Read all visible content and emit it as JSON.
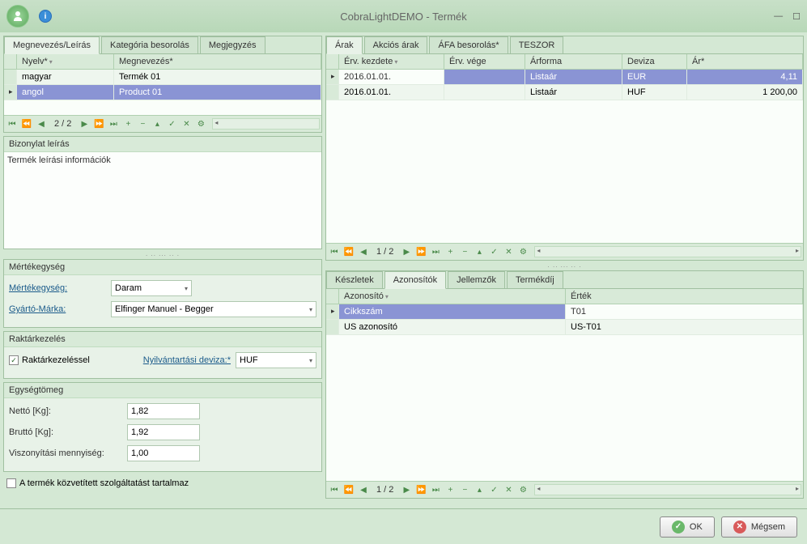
{
  "window": {
    "title": "CobraLightDEMO - Termék"
  },
  "left": {
    "tabs": [
      "Megnevezés/Leírás",
      "Kategória besorolás",
      "Megjegyzés"
    ],
    "activeTab": 0,
    "nameGrid": {
      "columns": [
        "Nyelv*",
        "Megnevezés*"
      ],
      "rows": [
        {
          "lang": "magyar",
          "name": "Termék 01",
          "selected": false
        },
        {
          "lang": "angol",
          "name": "Product 01",
          "selected": true
        }
      ],
      "nav": "2 / 2"
    },
    "descSection": {
      "title": "Bizonylat leírás",
      "text": "Termék leírási információk"
    },
    "unitSection": {
      "title": "Mértékegység",
      "unitLabel": "Mértékegység:",
      "unitValue": "Daram",
      "brandLabel": "Gyártó-Márka:",
      "brandValue": "Elfinger Manuel - Begger"
    },
    "stockSection": {
      "title": "Raktárkezelés",
      "checkbox": "Raktárkezeléssel",
      "currencyLabel": "Nyilvántartási deviza:*",
      "currencyValue": "HUF"
    },
    "massSection": {
      "title": "Egységtömeg",
      "nettoLabel": "Nettó [Kg]:",
      "nettoValue": "1,82",
      "bruttoLabel": "Bruttó [Kg]:",
      "bruttoValue": "1,92",
      "refLabel": "Viszonyítási mennyiség:",
      "refValue": "1,00"
    },
    "serviceCheckbox": "A termék közvetített szolgáltatást tartalmaz"
  },
  "right": {
    "priceTabs": [
      "Árak",
      "Akciós árak",
      "ÁFA besorolás*",
      "TESZOR"
    ],
    "priceActiveTab": 0,
    "priceGrid": {
      "columns": [
        "Érv. kezdete",
        "Érv. vége",
        "Árforma",
        "Deviza",
        "Ár*"
      ],
      "rows": [
        {
          "start": "2016.01.01.",
          "end": "",
          "form": "Listaár",
          "curr": "EUR",
          "price": "4,11",
          "selected": true
        },
        {
          "start": "2016.01.01.",
          "end": "",
          "form": "Listaár",
          "curr": "HUF",
          "price": "1 200,00",
          "selected": false
        }
      ],
      "nav": "1 / 2"
    },
    "idTabs": [
      "Készletek",
      "Azonosítók",
      "Jellemzők",
      "Termékdíj"
    ],
    "idActiveTab": 1,
    "idGrid": {
      "columns": [
        "Azonosító",
        "Érték"
      ],
      "rows": [
        {
          "id": "Cikkszám",
          "val": "T01",
          "selected": true
        },
        {
          "id": "US azonosító",
          "val": "US-T01",
          "selected": false
        }
      ],
      "nav": "1 / 2"
    }
  },
  "footer": {
    "ok": "OK",
    "cancel": "Mégsem"
  }
}
